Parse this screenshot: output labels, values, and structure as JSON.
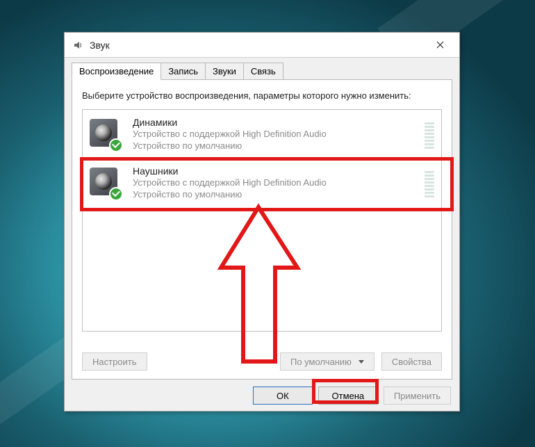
{
  "window": {
    "title": "Звук"
  },
  "tabs": [
    {
      "label": "Воспроизведение",
      "active": true
    },
    {
      "label": "Запись",
      "active": false
    },
    {
      "label": "Звуки",
      "active": false
    },
    {
      "label": "Связь",
      "active": false
    }
  ],
  "instruction": "Выберите устройство воспроизведения, параметры которого нужно изменить:",
  "devices": [
    {
      "name": "Динамики",
      "description": "Устройство с поддержкой High Definition Audio",
      "status": "Устройство по умолчанию",
      "default": true
    },
    {
      "name": "Наушники",
      "description": "Устройство с поддержкой High Definition Audio",
      "status": "Устройство по умолчанию",
      "default": true,
      "highlighted": true
    }
  ],
  "panel_buttons": {
    "configure": "Настроить",
    "set_default": "По умолчанию",
    "properties": "Свойства"
  },
  "dialog_buttons": {
    "ok": "ОК",
    "cancel": "Отмена",
    "apply": "Применить"
  },
  "annotation": {
    "highlight_color": "#e21818"
  }
}
